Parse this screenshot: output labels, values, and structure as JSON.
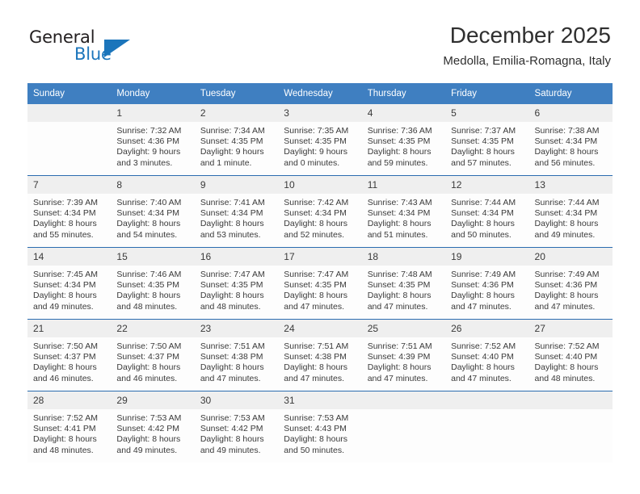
{
  "logo": {
    "text_top": "General",
    "text_bottom": "Blue",
    "triangle_name": "blue-triangle",
    "brand_color": "#1b75bb"
  },
  "header": {
    "title": "December 2025",
    "subtitle": "Medolla, Emilia-Romagna, Italy"
  },
  "theme": {
    "header_row_bg": "#3f7fc1",
    "row_divider": "#2b6cb0",
    "daynum_bg": "#efefef"
  },
  "weekdays": [
    "Sunday",
    "Monday",
    "Tuesday",
    "Wednesday",
    "Thursday",
    "Friday",
    "Saturday"
  ],
  "weeks": [
    [
      {
        "day": "",
        "sunrise": "",
        "sunset": "",
        "daylight1": "",
        "daylight2": ""
      },
      {
        "day": "1",
        "sunrise": "Sunrise: 7:32 AM",
        "sunset": "Sunset: 4:36 PM",
        "daylight1": "Daylight: 9 hours",
        "daylight2": "and 3 minutes."
      },
      {
        "day": "2",
        "sunrise": "Sunrise: 7:34 AM",
        "sunset": "Sunset: 4:35 PM",
        "daylight1": "Daylight: 9 hours",
        "daylight2": "and 1 minute."
      },
      {
        "day": "3",
        "sunrise": "Sunrise: 7:35 AM",
        "sunset": "Sunset: 4:35 PM",
        "daylight1": "Daylight: 9 hours",
        "daylight2": "and 0 minutes."
      },
      {
        "day": "4",
        "sunrise": "Sunrise: 7:36 AM",
        "sunset": "Sunset: 4:35 PM",
        "daylight1": "Daylight: 8 hours",
        "daylight2": "and 59 minutes."
      },
      {
        "day": "5",
        "sunrise": "Sunrise: 7:37 AM",
        "sunset": "Sunset: 4:35 PM",
        "daylight1": "Daylight: 8 hours",
        "daylight2": "and 57 minutes."
      },
      {
        "day": "6",
        "sunrise": "Sunrise: 7:38 AM",
        "sunset": "Sunset: 4:34 PM",
        "daylight1": "Daylight: 8 hours",
        "daylight2": "and 56 minutes."
      }
    ],
    [
      {
        "day": "7",
        "sunrise": "Sunrise: 7:39 AM",
        "sunset": "Sunset: 4:34 PM",
        "daylight1": "Daylight: 8 hours",
        "daylight2": "and 55 minutes."
      },
      {
        "day": "8",
        "sunrise": "Sunrise: 7:40 AM",
        "sunset": "Sunset: 4:34 PM",
        "daylight1": "Daylight: 8 hours",
        "daylight2": "and 54 minutes."
      },
      {
        "day": "9",
        "sunrise": "Sunrise: 7:41 AM",
        "sunset": "Sunset: 4:34 PM",
        "daylight1": "Daylight: 8 hours",
        "daylight2": "and 53 minutes."
      },
      {
        "day": "10",
        "sunrise": "Sunrise: 7:42 AM",
        "sunset": "Sunset: 4:34 PM",
        "daylight1": "Daylight: 8 hours",
        "daylight2": "and 52 minutes."
      },
      {
        "day": "11",
        "sunrise": "Sunrise: 7:43 AM",
        "sunset": "Sunset: 4:34 PM",
        "daylight1": "Daylight: 8 hours",
        "daylight2": "and 51 minutes."
      },
      {
        "day": "12",
        "sunrise": "Sunrise: 7:44 AM",
        "sunset": "Sunset: 4:34 PM",
        "daylight1": "Daylight: 8 hours",
        "daylight2": "and 50 minutes."
      },
      {
        "day": "13",
        "sunrise": "Sunrise: 7:44 AM",
        "sunset": "Sunset: 4:34 PM",
        "daylight1": "Daylight: 8 hours",
        "daylight2": "and 49 minutes."
      }
    ],
    [
      {
        "day": "14",
        "sunrise": "Sunrise: 7:45 AM",
        "sunset": "Sunset: 4:34 PM",
        "daylight1": "Daylight: 8 hours",
        "daylight2": "and 49 minutes."
      },
      {
        "day": "15",
        "sunrise": "Sunrise: 7:46 AM",
        "sunset": "Sunset: 4:35 PM",
        "daylight1": "Daylight: 8 hours",
        "daylight2": "and 48 minutes."
      },
      {
        "day": "16",
        "sunrise": "Sunrise: 7:47 AM",
        "sunset": "Sunset: 4:35 PM",
        "daylight1": "Daylight: 8 hours",
        "daylight2": "and 48 minutes."
      },
      {
        "day": "17",
        "sunrise": "Sunrise: 7:47 AM",
        "sunset": "Sunset: 4:35 PM",
        "daylight1": "Daylight: 8 hours",
        "daylight2": "and 47 minutes."
      },
      {
        "day": "18",
        "sunrise": "Sunrise: 7:48 AM",
        "sunset": "Sunset: 4:35 PM",
        "daylight1": "Daylight: 8 hours",
        "daylight2": "and 47 minutes."
      },
      {
        "day": "19",
        "sunrise": "Sunrise: 7:49 AM",
        "sunset": "Sunset: 4:36 PM",
        "daylight1": "Daylight: 8 hours",
        "daylight2": "and 47 minutes."
      },
      {
        "day": "20",
        "sunrise": "Sunrise: 7:49 AM",
        "sunset": "Sunset: 4:36 PM",
        "daylight1": "Daylight: 8 hours",
        "daylight2": "and 47 minutes."
      }
    ],
    [
      {
        "day": "21",
        "sunrise": "Sunrise: 7:50 AM",
        "sunset": "Sunset: 4:37 PM",
        "daylight1": "Daylight: 8 hours",
        "daylight2": "and 46 minutes."
      },
      {
        "day": "22",
        "sunrise": "Sunrise: 7:50 AM",
        "sunset": "Sunset: 4:37 PM",
        "daylight1": "Daylight: 8 hours",
        "daylight2": "and 46 minutes."
      },
      {
        "day": "23",
        "sunrise": "Sunrise: 7:51 AM",
        "sunset": "Sunset: 4:38 PM",
        "daylight1": "Daylight: 8 hours",
        "daylight2": "and 47 minutes."
      },
      {
        "day": "24",
        "sunrise": "Sunrise: 7:51 AM",
        "sunset": "Sunset: 4:38 PM",
        "daylight1": "Daylight: 8 hours",
        "daylight2": "and 47 minutes."
      },
      {
        "day": "25",
        "sunrise": "Sunrise: 7:51 AM",
        "sunset": "Sunset: 4:39 PM",
        "daylight1": "Daylight: 8 hours",
        "daylight2": "and 47 minutes."
      },
      {
        "day": "26",
        "sunrise": "Sunrise: 7:52 AM",
        "sunset": "Sunset: 4:40 PM",
        "daylight1": "Daylight: 8 hours",
        "daylight2": "and 47 minutes."
      },
      {
        "day": "27",
        "sunrise": "Sunrise: 7:52 AM",
        "sunset": "Sunset: 4:40 PM",
        "daylight1": "Daylight: 8 hours",
        "daylight2": "and 48 minutes."
      }
    ],
    [
      {
        "day": "28",
        "sunrise": "Sunrise: 7:52 AM",
        "sunset": "Sunset: 4:41 PM",
        "daylight1": "Daylight: 8 hours",
        "daylight2": "and 48 minutes."
      },
      {
        "day": "29",
        "sunrise": "Sunrise: 7:53 AM",
        "sunset": "Sunset: 4:42 PM",
        "daylight1": "Daylight: 8 hours",
        "daylight2": "and 49 minutes."
      },
      {
        "day": "30",
        "sunrise": "Sunrise: 7:53 AM",
        "sunset": "Sunset: 4:42 PM",
        "daylight1": "Daylight: 8 hours",
        "daylight2": "and 49 minutes."
      },
      {
        "day": "31",
        "sunrise": "Sunrise: 7:53 AM",
        "sunset": "Sunset: 4:43 PM",
        "daylight1": "Daylight: 8 hours",
        "daylight2": "and 50 minutes."
      },
      {
        "day": "",
        "sunrise": "",
        "sunset": "",
        "daylight1": "",
        "daylight2": ""
      },
      {
        "day": "",
        "sunrise": "",
        "sunset": "",
        "daylight1": "",
        "daylight2": ""
      },
      {
        "day": "",
        "sunrise": "",
        "sunset": "",
        "daylight1": "",
        "daylight2": ""
      }
    ]
  ]
}
